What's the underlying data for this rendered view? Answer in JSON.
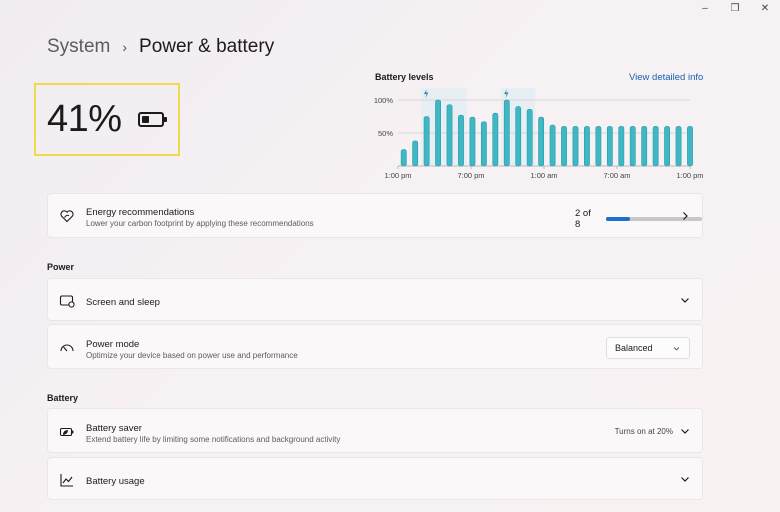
{
  "window": {
    "controls": [
      {
        "name": "minimize",
        "glyph": "–"
      },
      {
        "name": "maximize",
        "glyph": "❐"
      },
      {
        "name": "close",
        "glyph": "✕"
      }
    ]
  },
  "breadcrumb": {
    "parent": "System",
    "separator": "›",
    "current": "Power & battery"
  },
  "battery_summary": {
    "percent_label": "41%",
    "level_fraction": 0.41
  },
  "chart_header": {
    "title": "Battery levels",
    "link": "View detailed info"
  },
  "chart_data": {
    "type": "bar",
    "title": "Battery levels",
    "ytick_labels": [
      "100%",
      "50%"
    ],
    "yticks": [
      100,
      50
    ],
    "ylim": [
      0,
      100
    ],
    "xtick_labels": [
      "1:00 pm",
      "7:00 pm",
      "1:00 am",
      "7:00 am",
      "1:00 pm"
    ],
    "values": [
      25,
      38,
      75,
      100,
      93,
      77,
      74,
      67,
      80,
      100,
      90,
      86,
      74,
      62,
      60,
      60,
      60,
      60,
      60,
      60,
      60,
      60,
      60,
      60,
      60,
      60
    ],
    "charging_ranges": [
      [
        2,
        5
      ],
      [
        9,
        11
      ]
    ],
    "grid": true,
    "bar_color": "#3fb7c4",
    "charging_shade_color": "#e4eef3"
  },
  "energy": {
    "title": "Energy recommendations",
    "subtitle": "Lower your carbon footprint by applying these recommendations",
    "progress_text": "2 of 8",
    "progress_fraction": 0.25
  },
  "sections": {
    "power": "Power",
    "battery": "Battery"
  },
  "screen_sleep": {
    "title": "Screen and sleep"
  },
  "power_mode": {
    "title": "Power mode",
    "subtitle": "Optimize your device based on power use and performance",
    "selected": "Balanced"
  },
  "battery_saver": {
    "title": "Battery saver",
    "subtitle": "Extend battery life by limiting some notifications and background activity",
    "status": "Turns on at 20%"
  },
  "battery_usage": {
    "title": "Battery usage"
  },
  "colors": {
    "accent": "#1a6fd1",
    "highlight_border": "#f0d94a",
    "link": "#1a5fb4"
  }
}
